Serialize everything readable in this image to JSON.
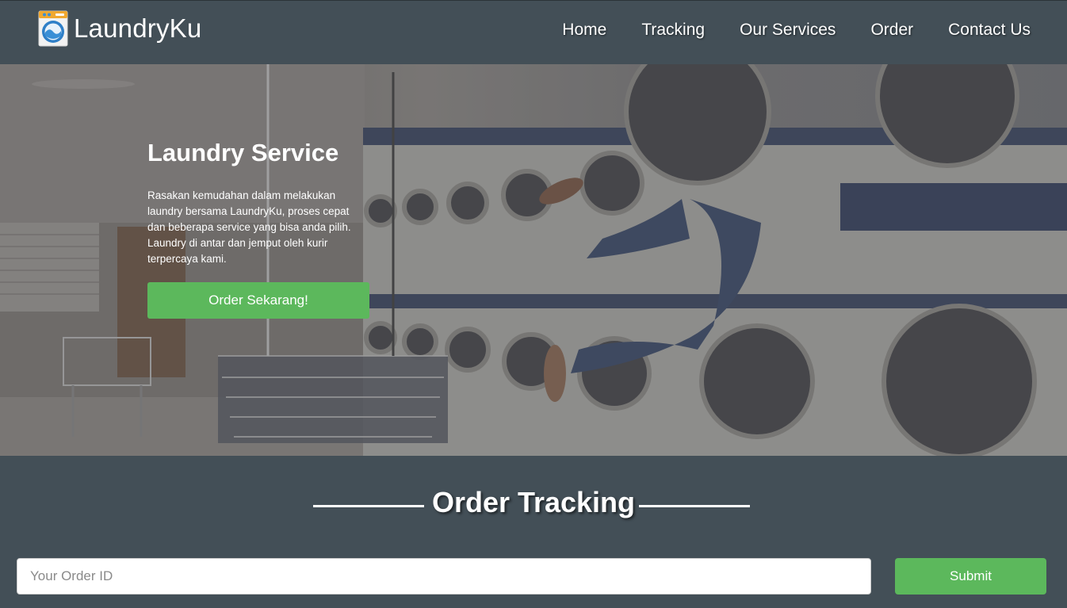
{
  "navbar": {
    "brand": "LaundryKu",
    "links": [
      "Home",
      "Tracking",
      "Our Services",
      "Order",
      "Contact Us"
    ]
  },
  "hero": {
    "title": "Laundry Service",
    "description": "Rasakan kemudahan dalam melakukan laundry bersama LaundryKu, proses cepat dan beberapa service yang bisa anda pilih. Laundry di antar dan jemput oleh kurir terpercaya kami.",
    "cta_label": "Order Sekarang!"
  },
  "tracking": {
    "title": "Order Tracking",
    "input_placeholder": "Your Order ID",
    "input_value": "",
    "submit_label": "Submit"
  },
  "colors": {
    "nav_bg": "#434f57",
    "accent_green": "#5cb85c",
    "text_white": "#ffffff"
  },
  "icons": [
    "washing-machine-logo-icon"
  ]
}
